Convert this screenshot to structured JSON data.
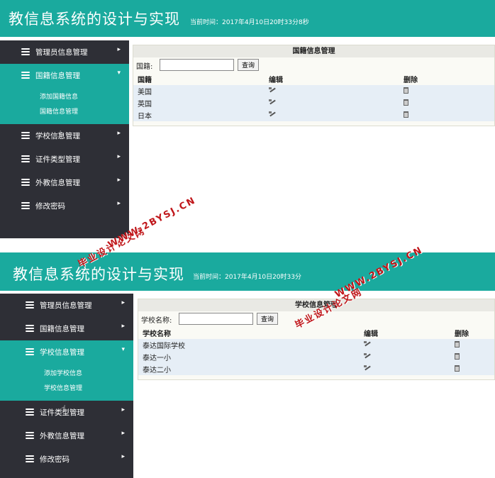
{
  "app": {
    "title": "教信息系统的设计与实现",
    "time_label": "当前时间：2017年4月10日20时33分8秒",
    "time_label2": "当前时间：2017年4月10日20时33分"
  },
  "shot1": {
    "nav": [
      {
        "label": "管理员信息管理",
        "arrow": "▸"
      },
      {
        "label": "国籍信息管理",
        "arrow": "▾"
      },
      {
        "label": "学校信息管理",
        "arrow": "▸"
      },
      {
        "label": "证件类型管理",
        "arrow": "▸"
      },
      {
        "label": "外教信息管理",
        "arrow": "▸"
      },
      {
        "label": "修改密码",
        "arrow": "▸"
      }
    ],
    "submenu": [
      "添加国籍信息",
      "国籍信息管理"
    ],
    "panel": {
      "title": "国籍信息管理",
      "search_label": "国籍:",
      "search_button": "查询",
      "columns": [
        "国籍",
        "编辑",
        "删除"
      ],
      "rows": [
        "美国",
        "英国",
        "日本"
      ]
    }
  },
  "shot2": {
    "nav": [
      {
        "label": "管理员信息管理",
        "arrow": "▸"
      },
      {
        "label": "国籍信息管理",
        "arrow": "▸"
      },
      {
        "label": "学校信息管理",
        "arrow": "▾"
      },
      {
        "label": "证件类型管理",
        "arrow": "▸"
      },
      {
        "label": "外教信息管理",
        "arrow": "▸"
      },
      {
        "label": "修改密码",
        "arrow": "▸"
      }
    ],
    "submenu": [
      "添加学校信息",
      "学校信息管理"
    ],
    "panel": {
      "title": "学校信息管理",
      "search_label": "学校名称:",
      "search_button": "查询",
      "columns": [
        "学校名称",
        "编辑",
        "删除"
      ],
      "rows": [
        "泰达国际学校",
        "泰达一小",
        "泰达二小"
      ]
    }
  },
  "watermark": {
    "line1": "毕业设计论文网",
    "line2": "WWW.2BYSJ.CN",
    "color": "#c0161a"
  },
  "colors": {
    "accent": "#1aaa9e",
    "sidebar": "#2e2f36"
  }
}
